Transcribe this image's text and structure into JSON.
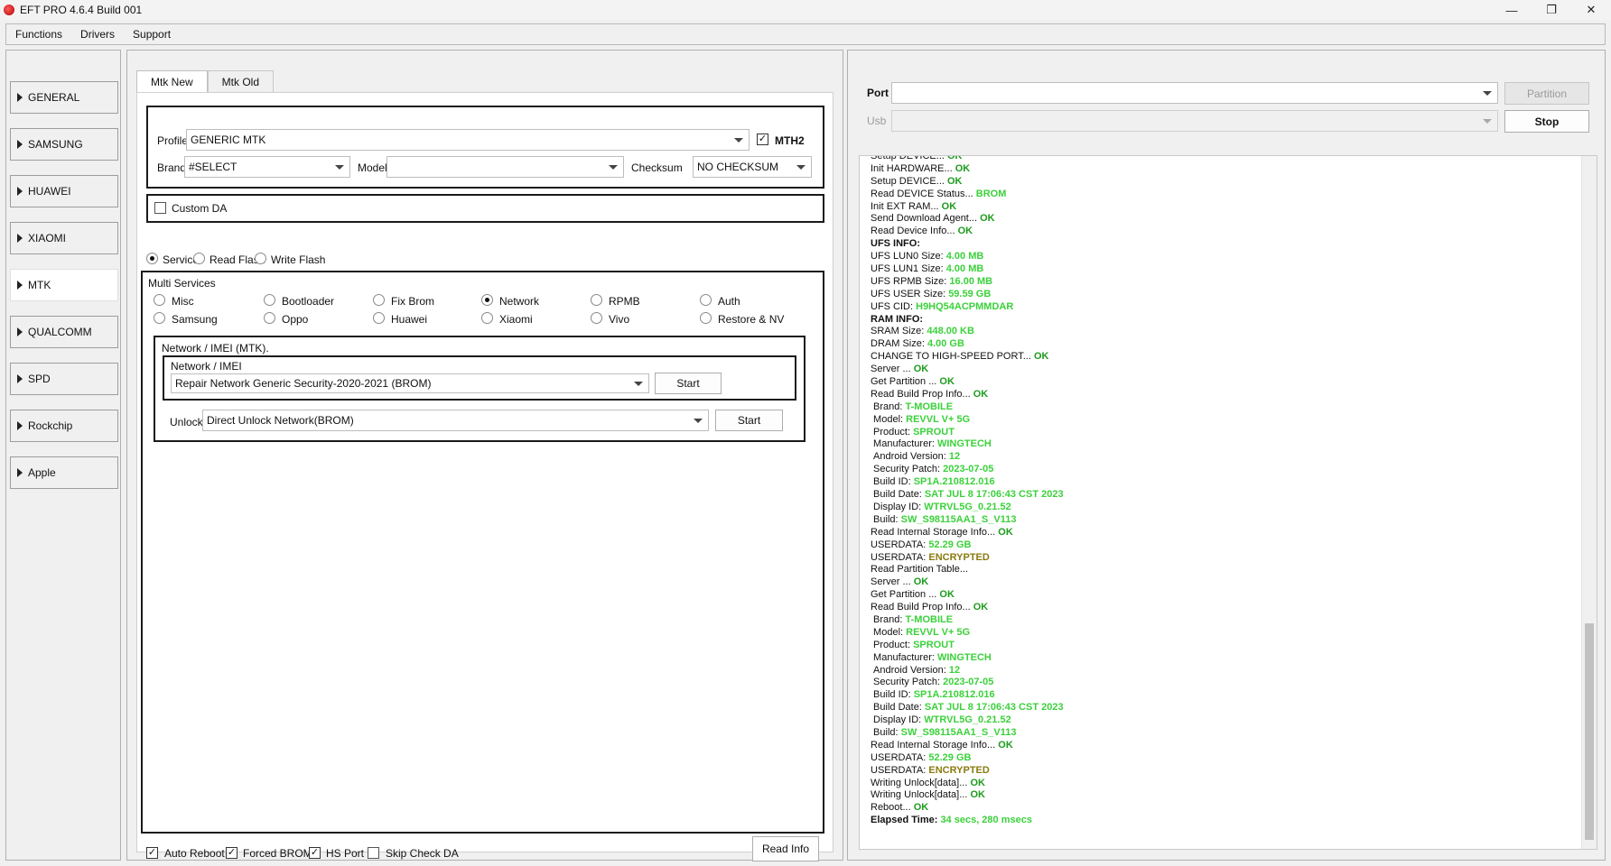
{
  "window": {
    "title": "EFT PRO 4.6.4 Build 001",
    "controls": {
      "minimize": "—",
      "restore": "❐",
      "close": "✕"
    }
  },
  "menu": [
    "Functions",
    "Drivers",
    "Support"
  ],
  "sidebar": {
    "items": [
      {
        "label": "GENERAL"
      },
      {
        "label": "SAMSUNG"
      },
      {
        "label": "HUAWEI"
      },
      {
        "label": "XIAOMI"
      },
      {
        "label": "MTK",
        "active": true
      },
      {
        "label": "QUALCOMM"
      },
      {
        "label": "SPD"
      },
      {
        "label": "Rockchip"
      },
      {
        "label": "Apple"
      }
    ]
  },
  "tabs": [
    {
      "label": "Mtk New",
      "active": true
    },
    {
      "label": "Mtk Old"
    }
  ],
  "profile": {
    "label": "Profile",
    "value": "GENERIC MTK",
    "mth2_label": "MTH2",
    "mth2_checked": true,
    "brand_label": "Brand",
    "brand_value": "#SELECT",
    "model_label": "Model",
    "model_value": "",
    "checksum_label": "Checksum",
    "checksum_value": "NO CHECKSUM"
  },
  "custom_da": {
    "label": "Custom DA",
    "checked": false
  },
  "modes": [
    {
      "label": "Service",
      "selected": true
    },
    {
      "label": "Read Flash",
      "selected": false
    },
    {
      "label": "Write Flash",
      "selected": false
    }
  ],
  "multi_services": {
    "title": "Multi Services",
    "row1": [
      {
        "label": "Misc"
      },
      {
        "label": "Bootloader"
      },
      {
        "label": "Fix Brom"
      },
      {
        "label": "Network",
        "selected": true
      },
      {
        "label": "RPMB"
      },
      {
        "label": "Auth"
      }
    ],
    "row2": [
      {
        "label": "Samsung"
      },
      {
        "label": "Oppo"
      },
      {
        "label": "Huawei"
      },
      {
        "label": "Xiaomi"
      },
      {
        "label": "Vivo"
      },
      {
        "label": "Restore & NV"
      }
    ]
  },
  "network_group": {
    "title": "Network / IMEI (MTK).",
    "inner_title": "Network / IMEI",
    "repair_value": "Repair Network  Generic Security-2020-2021 (BROM)",
    "start_label": "Start",
    "unlock_label": "Unlock",
    "unlock_value": "Direct Unlock Network(BROM)",
    "unlock_start_label": "Start"
  },
  "bottom": {
    "options": [
      {
        "label": "Auto Reboot",
        "checked": true
      },
      {
        "label": "Forced BROM",
        "checked": true
      },
      {
        "label": "HS Port",
        "checked": true
      },
      {
        "label": "Skip Check DA",
        "checked": false
      }
    ],
    "read_info_label": "Read Info"
  },
  "port_panel": {
    "port_label": "Port",
    "port_value": "",
    "partition_label": "Partition",
    "usb_label": "Usb",
    "usb_value": "",
    "stop_label": "Stop"
  },
  "log": [
    {
      "t": "Setup DEVICE... ",
      "v": "OK",
      "c": "ok"
    },
    {
      "t": "Init HARDWARE... ",
      "v": "OK",
      "c": "ok"
    },
    {
      "t": "Setup DEVICE... ",
      "v": "OK",
      "c": "ok"
    },
    {
      "t": "Read DEVICE Status... ",
      "v": "BROM",
      "c": "val"
    },
    {
      "t": "Init EXT RAM... ",
      "v": "OK",
      "c": "ok"
    },
    {
      "t": "Send Download Agent... ",
      "v": "OK",
      "c": "ok"
    },
    {
      "t": "Read Device Info... ",
      "v": "OK",
      "c": "ok"
    },
    {
      "t": "UFS INFO:",
      "v": "",
      "c": "",
      "bold": true
    },
    {
      "t": "UFS LUN0 Size: ",
      "v": "4.00 MB",
      "c": "val"
    },
    {
      "t": "UFS LUN1 Size: ",
      "v": "4.00 MB",
      "c": "val"
    },
    {
      "t": "UFS RPMB Size: ",
      "v": "16.00 MB",
      "c": "val"
    },
    {
      "t": "UFS USER Size: ",
      "v": "59.59 GB",
      "c": "val"
    },
    {
      "t": "UFS CID: ",
      "v": "H9HQ54ACPMMDAR",
      "c": "val"
    },
    {
      "t": "RAM INFO:",
      "v": "",
      "c": "",
      "bold": true
    },
    {
      "t": "SRAM Size: ",
      "v": "448.00 KB",
      "c": "val"
    },
    {
      "t": "DRAM Size: ",
      "v": "4.00 GB",
      "c": "val"
    },
    {
      "t": "CHANGE TO HIGH-SPEED PORT... ",
      "v": "OK",
      "c": "ok"
    },
    {
      "t": "Server ... ",
      "v": "OK",
      "c": "ok"
    },
    {
      "t": "Get Partition ... ",
      "v": "OK",
      "c": "ok"
    },
    {
      "t": "Read Build Prop Info... ",
      "v": "OK",
      "c": "ok"
    },
    {
      "t": " Brand: ",
      "v": "T-MOBILE",
      "c": "val"
    },
    {
      "t": " Model: ",
      "v": "REVVL V+ 5G",
      "c": "val"
    },
    {
      "t": " Product: ",
      "v": "SPROUT",
      "c": "val"
    },
    {
      "t": " Manufacturer: ",
      "v": "WINGTECH",
      "c": "val"
    },
    {
      "t": " Android Version: ",
      "v": "12",
      "c": "val"
    },
    {
      "t": " Security Patch: ",
      "v": "2023-07-05",
      "c": "val"
    },
    {
      "t": " Build ID: ",
      "v": "SP1A.210812.016",
      "c": "val"
    },
    {
      "t": " Build Date: ",
      "v": "SAT JUL  8 17:06:43 CST 2023",
      "c": "val"
    },
    {
      "t": " Display ID: ",
      "v": "WTRVL5G_0.21.52",
      "c": "val"
    },
    {
      "t": " Build: ",
      "v": "SW_S98115AA1_S_V113",
      "c": "val"
    },
    {
      "t": "Read Internal Storage Info... ",
      "v": "OK",
      "c": "ok"
    },
    {
      "t": "USERDATA: ",
      "v": "52.29 GB",
      "c": "val"
    },
    {
      "t": "USERDATA: ",
      "v": "ENCRYPTED",
      "c": "enc"
    },
    {
      "t": "Read Partition Table...",
      "v": "",
      "c": ""
    },
    {
      "t": "Server ... ",
      "v": "OK",
      "c": "ok"
    },
    {
      "t": "Get Partition ... ",
      "v": "OK",
      "c": "ok"
    },
    {
      "t": "Read Build Prop Info... ",
      "v": "OK",
      "c": "ok"
    },
    {
      "t": " Brand: ",
      "v": "T-MOBILE",
      "c": "val"
    },
    {
      "t": " Model: ",
      "v": "REVVL V+ 5G",
      "c": "val"
    },
    {
      "t": " Product: ",
      "v": "SPROUT",
      "c": "val"
    },
    {
      "t": " Manufacturer: ",
      "v": "WINGTECH",
      "c": "val"
    },
    {
      "t": " Android Version: ",
      "v": "12",
      "c": "val"
    },
    {
      "t": " Security Patch: ",
      "v": "2023-07-05",
      "c": "val"
    },
    {
      "t": " Build ID: ",
      "v": "SP1A.210812.016",
      "c": "val"
    },
    {
      "t": " Build Date: ",
      "v": "SAT JUL  8 17:06:43 CST 2023",
      "c": "val"
    },
    {
      "t": " Display ID: ",
      "v": "WTRVL5G_0.21.52",
      "c": "val"
    },
    {
      "t": " Build: ",
      "v": "SW_S98115AA1_S_V113",
      "c": "val"
    },
    {
      "t": "Read Internal Storage Info... ",
      "v": "OK",
      "c": "ok"
    },
    {
      "t": "USERDATA: ",
      "v": "52.29 GB",
      "c": "val"
    },
    {
      "t": "USERDATA: ",
      "v": "ENCRYPTED",
      "c": "enc"
    },
    {
      "t": "Writing Unlock[data]... ",
      "v": "OK",
      "c": "ok"
    },
    {
      "t": "Writing Unlock[data]... ",
      "v": "OK",
      "c": "ok"
    },
    {
      "t": "Reboot... ",
      "v": "OK",
      "c": "ok"
    },
    {
      "t": "Elapsed Time: ",
      "v": "34 secs, 280 msecs",
      "c": "val",
      "bold": true
    }
  ]
}
